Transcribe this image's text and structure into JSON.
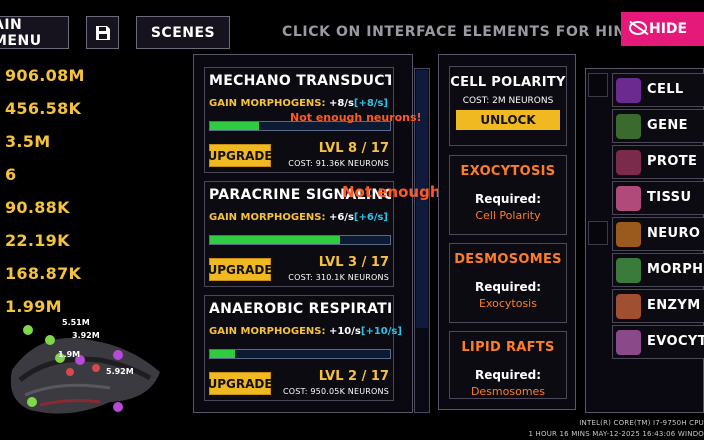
{
  "toolbar": {
    "main_menu_label": "AIN MENU",
    "save_icon": "floppy-disk-icon",
    "scenes_label": "SCENES",
    "hint_text": "CLICK ON INTERFACE ELEMENTS FOR HINTS",
    "hide_label": "HIDE"
  },
  "resources": [
    "906.08M",
    "456.58K",
    "3.5M",
    "6",
    "90.88K",
    "22.19K",
    "168.87K",
    "1.99M"
  ],
  "upgrades": [
    {
      "name": "MECHANO TRANSDUCTION",
      "gain_label": "GAIN MORPHOGENS:",
      "rate": "+8/s",
      "delta": "[+8/s]",
      "progress": 0.27,
      "button": "UPGRADE",
      "level": "LVL 8 / 17",
      "cost": "COST: 91.36K NEURONS"
    },
    {
      "name": "PARACRINE SIGNALING",
      "gain_label": "GAIN MORPHOGENS:",
      "rate": "+6/s",
      "delta": "[+6/s]",
      "progress": 0.72,
      "button": "UPGRADE",
      "level": "LVL 3 / 17",
      "cost": "COST: 310.1K NEURONS"
    },
    {
      "name": "ANAEROBIC RESPIRATION",
      "gain_label": "GAIN MORPHOGENS:",
      "rate": "+10/s",
      "delta": "[+10/s]",
      "progress": 0.14,
      "button": "UPGRADE",
      "level": "LVL 2 / 17",
      "cost": "COST: 950.05K NEURONS"
    }
  ],
  "floating_messages": [
    "Not enough neurons!",
    "Not enough neurons!"
  ],
  "cell_skills": {
    "cell_polarity": {
      "title": "CELL POLARITY",
      "cost": "COST: 2M NEURONS",
      "button": "UNLOCK"
    },
    "locked": [
      {
        "title": "EXOCYTOSIS",
        "required_label": "Required:",
        "required": "Cell Polarity"
      },
      {
        "title": "DESMOSOMES",
        "required_label": "Required:",
        "required": "Exocytosis"
      },
      {
        "title": "LIPID RAFTS",
        "required_label": "Required:",
        "required": "Desmosomes"
      }
    ]
  },
  "categories": [
    {
      "label": "CELL",
      "icon": "cell-icon",
      "color": "#6b2a8f"
    },
    {
      "label": "GENE",
      "icon": "dna-icon",
      "color": "#3a6a2e"
    },
    {
      "label": "PROTE",
      "icon": "protein-icon",
      "color": "#7a2a4a"
    },
    {
      "label": "TISSU",
      "icon": "tissue-icon",
      "color": "#b04a7a"
    },
    {
      "label": "NEURO",
      "icon": "neuron-icon",
      "color": "#9a5a1e"
    },
    {
      "label": "MORPHOG",
      "icon": "morphogen-icon",
      "color": "#3a7a3a"
    },
    {
      "label": "ENZYM",
      "icon": "enzyme-icon",
      "color": "#a05030"
    },
    {
      "label": "EVOCYT",
      "icon": "evocyte-icon",
      "color": "#8a4a8a"
    }
  ],
  "creature_labels": [
    "5.51M",
    "3.92M",
    "5.92M",
    "1.9M"
  ],
  "system_info": {
    "cpu": "INTEL(R) CORE(TM) I7-9750H CPU",
    "status": "1 HOUR 16 MINS   MAY-12-2025 16:43:06   WINDO"
  },
  "colors": {
    "accent_yellow": "#f0b821",
    "hide_pink": "#e5197a",
    "locked_orange": "#ff7d26",
    "progress_green": "#2ecc40"
  }
}
